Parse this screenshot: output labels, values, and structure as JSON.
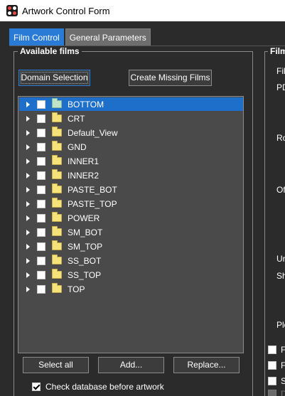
{
  "window": {
    "title": "Artwork Control Form",
    "icon": "artwork-app-icon"
  },
  "tabs": [
    {
      "label": "Film Control",
      "active": true
    },
    {
      "label": "General Parameters",
      "active": false
    }
  ],
  "available_films": {
    "title": "Available films",
    "domain_selection_label": "Domain Selection",
    "create_missing_label": "Create Missing Films",
    "films": [
      {
        "label": "BOTTOM",
        "selected": true,
        "checked": false
      },
      {
        "label": "CRT",
        "selected": false,
        "checked": false
      },
      {
        "label": "Default_View",
        "selected": false,
        "checked": false
      },
      {
        "label": "GND",
        "selected": false,
        "checked": false
      },
      {
        "label": "INNER1",
        "selected": false,
        "checked": false
      },
      {
        "label": "INNER2",
        "selected": false,
        "checked": false
      },
      {
        "label": "PASTE_BOT",
        "selected": false,
        "checked": false
      },
      {
        "label": "PASTE_TOP",
        "selected": false,
        "checked": false
      },
      {
        "label": "POWER",
        "selected": false,
        "checked": false
      },
      {
        "label": "SM_BOT",
        "selected": false,
        "checked": false
      },
      {
        "label": "SM_TOP",
        "selected": false,
        "checked": false
      },
      {
        "label": "SS_BOT",
        "selected": false,
        "checked": false
      },
      {
        "label": "SS_TOP",
        "selected": false,
        "checked": false
      },
      {
        "label": "TOP",
        "selected": false,
        "checked": false
      }
    ],
    "select_all_label": "Select all",
    "add_label": "Add...",
    "replace_label": "Replace...",
    "check_database_label": "Check database before artwork",
    "check_database_checked": true
  },
  "film_options": {
    "title": "Film",
    "labels": [
      "Fil",
      "PD",
      "Ro",
      "Of",
      "Ur",
      "Sh",
      "Plo"
    ],
    "checkbox_labels": [
      "F",
      "F",
      "S",
      "D"
    ]
  },
  "colors": {
    "background": "#2b2b2b",
    "accent": "#2a7bd6",
    "selected_row": "#1e6fc9",
    "tree_bg": "#4a4a4a"
  }
}
